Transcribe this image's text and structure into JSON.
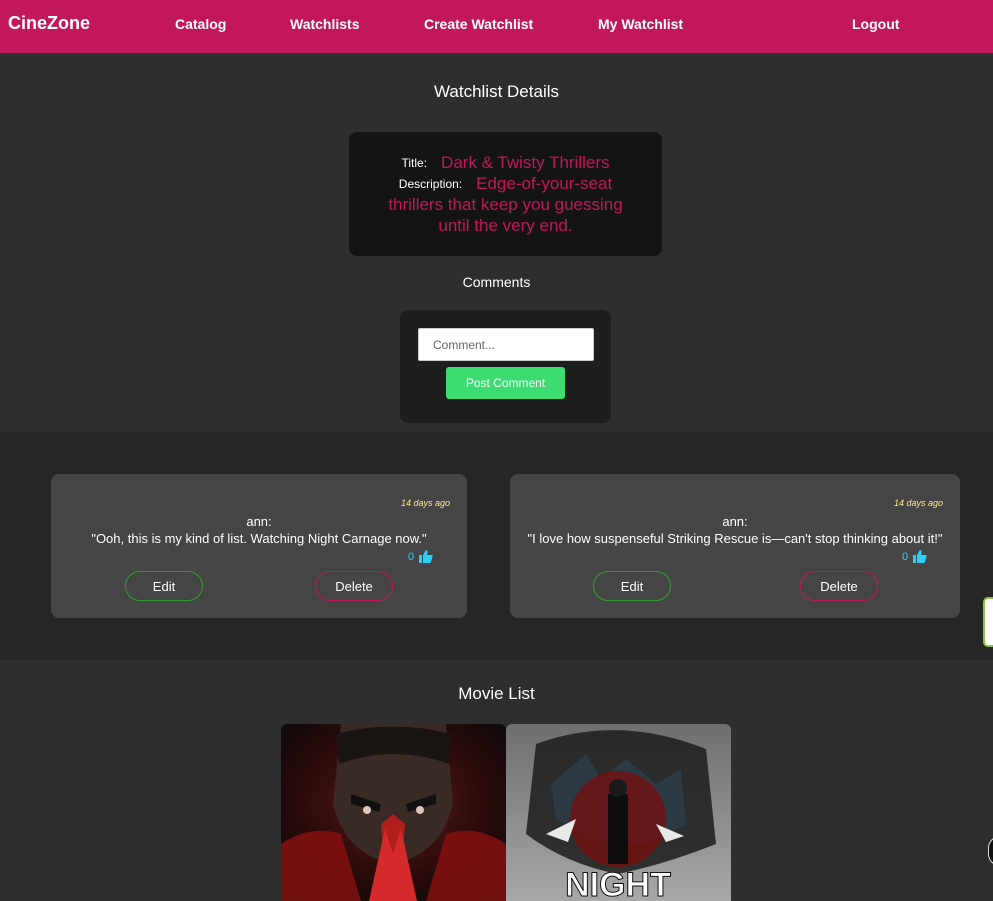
{
  "nav": {
    "brand": "CineZone",
    "links": [
      "Catalog",
      "Watchlists",
      "Create Watchlist",
      "My Watchlist",
      "Logout"
    ]
  },
  "page": {
    "details_heading": "Watchlist Details",
    "comments_heading": "Comments",
    "movies_heading": "Movie List"
  },
  "watchlist": {
    "title_label": "Title:",
    "title": "Dark & Twisty Thrillers",
    "description_label": "Description:",
    "description": "Edge-of-your-seat thrillers that keep you guessing until the very end."
  },
  "comment_form": {
    "placeholder": "Comment...",
    "submit_label": "Post Comment"
  },
  "comments": [
    {
      "time": "14 days ago",
      "author": "ann:",
      "text": "\"Ooh, this is my kind of list. Watching Night Carnage now.\"",
      "likes": "0",
      "edit_label": "Edit",
      "delete_label": "Delete"
    },
    {
      "time": "14 days ago",
      "author": "ann:",
      "text": "\"I love how suspenseful Striking Rescue is—can't stop thinking about it!\"",
      "likes": "0",
      "edit_label": "Edit",
      "delete_label": "Delete"
    }
  ],
  "movies": [
    {
      "poster": "man-praying-red-poster"
    },
    {
      "poster": "night-carnage-poster",
      "poster_text": "NIGHT"
    }
  ],
  "colors": {
    "brand": "#c2185b",
    "background": "#2e2e2e",
    "post_button": "#3ddc72",
    "likes": "#29d0ff",
    "timestamp": "#ffeb8a",
    "edit_border": "#2e9d2e"
  },
  "icons": [
    "thumbs-up-icon"
  ]
}
